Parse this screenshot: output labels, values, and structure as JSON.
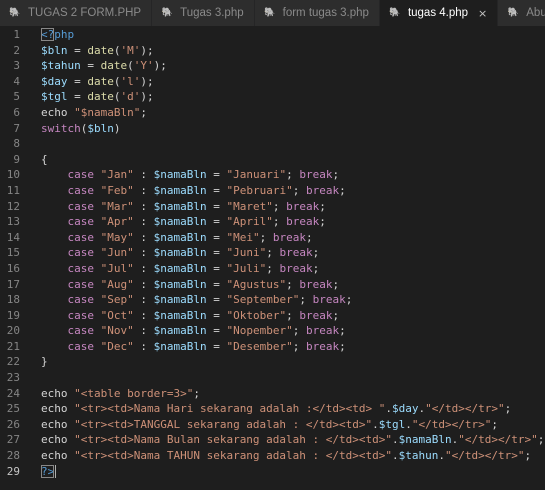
{
  "tabs": [
    {
      "label": "TUGAS 2 FORM.PHP",
      "active": false
    },
    {
      "label": "Tugas 3.php",
      "active": false
    },
    {
      "label": "form tugas 3.php",
      "active": false
    },
    {
      "label": "tugas 4.php",
      "active": true
    },
    {
      "label": "Abuj",
      "active": false
    }
  ],
  "tab_icon": "php-elephant-icon",
  "close_glyph": "×",
  "editor": {
    "current_line": 29,
    "lines": [
      {
        "n": "1",
        "tokens": [
          {
            "t": "<?",
            "c": "t-tag",
            "m": true
          },
          {
            "t": "php",
            "c": "t-tag"
          }
        ]
      },
      {
        "n": "2",
        "tokens": [
          {
            "t": "$bln",
            "c": "t-var"
          },
          {
            "t": " = ",
            "c": "t-plain"
          },
          {
            "t": "date",
            "c": "t-fn"
          },
          {
            "t": "(",
            "c": "t-plain"
          },
          {
            "t": "'M'",
            "c": "t-str"
          },
          {
            "t": ");",
            "c": "t-plain"
          }
        ]
      },
      {
        "n": "3",
        "tokens": [
          {
            "t": "$tahun",
            "c": "t-var"
          },
          {
            "t": " = ",
            "c": "t-plain"
          },
          {
            "t": "date",
            "c": "t-fn"
          },
          {
            "t": "(",
            "c": "t-plain"
          },
          {
            "t": "'Y'",
            "c": "t-str"
          },
          {
            "t": ");",
            "c": "t-plain"
          }
        ]
      },
      {
        "n": "4",
        "tokens": [
          {
            "t": "$day",
            "c": "t-var"
          },
          {
            "t": " = ",
            "c": "t-plain"
          },
          {
            "t": "date",
            "c": "t-fn"
          },
          {
            "t": "(",
            "c": "t-plain"
          },
          {
            "t": "'l'",
            "c": "t-str"
          },
          {
            "t": ");",
            "c": "t-plain"
          }
        ]
      },
      {
        "n": "5",
        "tokens": [
          {
            "t": "$tgl",
            "c": "t-var"
          },
          {
            "t": " = ",
            "c": "t-plain"
          },
          {
            "t": "date",
            "c": "t-fn"
          },
          {
            "t": "(",
            "c": "t-plain"
          },
          {
            "t": "'d'",
            "c": "t-str"
          },
          {
            "t": ");",
            "c": "t-plain"
          }
        ]
      },
      {
        "n": "6",
        "tokens": [
          {
            "t": "echo",
            "c": "t-plain"
          },
          {
            "t": " ",
            "c": "t-plain"
          },
          {
            "t": "\"$namaBln\"",
            "c": "t-str"
          },
          {
            "t": ";",
            "c": "t-plain"
          }
        ]
      },
      {
        "n": "7",
        "tokens": [
          {
            "t": "switch",
            "c": "t-kw"
          },
          {
            "t": "(",
            "c": "t-plain"
          },
          {
            "t": "$bln",
            "c": "t-var"
          },
          {
            "t": ")",
            "c": "t-plain"
          }
        ]
      },
      {
        "n": "8",
        "tokens": []
      },
      {
        "n": "9",
        "tokens": [
          {
            "t": "{",
            "c": "t-plain"
          }
        ]
      },
      {
        "n": "10",
        "tokens": [
          {
            "t": "    case ",
            "c": "t-kw"
          },
          {
            "t": "\"Jan\"",
            "c": "t-str"
          },
          {
            "t": " : ",
            "c": "t-plain"
          },
          {
            "t": "$namaBln",
            "c": "t-var"
          },
          {
            "t": " = ",
            "c": "t-plain"
          },
          {
            "t": "\"Januari\"",
            "c": "t-str"
          },
          {
            "t": "; ",
            "c": "t-plain"
          },
          {
            "t": "break",
            "c": "t-kw"
          },
          {
            "t": ";",
            "c": "t-plain"
          }
        ]
      },
      {
        "n": "11",
        "tokens": [
          {
            "t": "    case ",
            "c": "t-kw"
          },
          {
            "t": "\"Feb\"",
            "c": "t-str"
          },
          {
            "t": " : ",
            "c": "t-plain"
          },
          {
            "t": "$namaBln",
            "c": "t-var"
          },
          {
            "t": " = ",
            "c": "t-plain"
          },
          {
            "t": "\"Pebruari\"",
            "c": "t-str"
          },
          {
            "t": "; ",
            "c": "t-plain"
          },
          {
            "t": "break",
            "c": "t-kw"
          },
          {
            "t": ";",
            "c": "t-plain"
          }
        ]
      },
      {
        "n": "12",
        "tokens": [
          {
            "t": "    case ",
            "c": "t-kw"
          },
          {
            "t": "\"Mar\"",
            "c": "t-str"
          },
          {
            "t": " : ",
            "c": "t-plain"
          },
          {
            "t": "$namaBln",
            "c": "t-var"
          },
          {
            "t": " = ",
            "c": "t-plain"
          },
          {
            "t": "\"Maret\"",
            "c": "t-str"
          },
          {
            "t": "; ",
            "c": "t-plain"
          },
          {
            "t": "break",
            "c": "t-kw"
          },
          {
            "t": ";",
            "c": "t-plain"
          }
        ]
      },
      {
        "n": "13",
        "tokens": [
          {
            "t": "    case ",
            "c": "t-kw"
          },
          {
            "t": "\"Apr\"",
            "c": "t-str"
          },
          {
            "t": " : ",
            "c": "t-plain"
          },
          {
            "t": "$namaBln",
            "c": "t-var"
          },
          {
            "t": " = ",
            "c": "t-plain"
          },
          {
            "t": "\"April\"",
            "c": "t-str"
          },
          {
            "t": "; ",
            "c": "t-plain"
          },
          {
            "t": "break",
            "c": "t-kw"
          },
          {
            "t": ";",
            "c": "t-plain"
          }
        ]
      },
      {
        "n": "14",
        "tokens": [
          {
            "t": "    case ",
            "c": "t-kw"
          },
          {
            "t": "\"May\"",
            "c": "t-str"
          },
          {
            "t": " : ",
            "c": "t-plain"
          },
          {
            "t": "$namaBln",
            "c": "t-var"
          },
          {
            "t": " = ",
            "c": "t-plain"
          },
          {
            "t": "\"Mei\"",
            "c": "t-str"
          },
          {
            "t": "; ",
            "c": "t-plain"
          },
          {
            "t": "break",
            "c": "t-kw"
          },
          {
            "t": ";",
            "c": "t-plain"
          }
        ]
      },
      {
        "n": "15",
        "tokens": [
          {
            "t": "    case ",
            "c": "t-kw"
          },
          {
            "t": "\"Jun\"",
            "c": "t-str"
          },
          {
            "t": " : ",
            "c": "t-plain"
          },
          {
            "t": "$namaBln",
            "c": "t-var"
          },
          {
            "t": " = ",
            "c": "t-plain"
          },
          {
            "t": "\"Juni\"",
            "c": "t-str"
          },
          {
            "t": "; ",
            "c": "t-plain"
          },
          {
            "t": "break",
            "c": "t-kw"
          },
          {
            "t": ";",
            "c": "t-plain"
          }
        ]
      },
      {
        "n": "16",
        "tokens": [
          {
            "t": "    case ",
            "c": "t-kw"
          },
          {
            "t": "\"Jul\"",
            "c": "t-str"
          },
          {
            "t": " : ",
            "c": "t-plain"
          },
          {
            "t": "$namaBln",
            "c": "t-var"
          },
          {
            "t": " = ",
            "c": "t-plain"
          },
          {
            "t": "\"Juli\"",
            "c": "t-str"
          },
          {
            "t": "; ",
            "c": "t-plain"
          },
          {
            "t": "break",
            "c": "t-kw"
          },
          {
            "t": ";",
            "c": "t-plain"
          }
        ]
      },
      {
        "n": "17",
        "tokens": [
          {
            "t": "    case ",
            "c": "t-kw"
          },
          {
            "t": "\"Aug\"",
            "c": "t-str"
          },
          {
            "t": " : ",
            "c": "t-plain"
          },
          {
            "t": "$namaBln",
            "c": "t-var"
          },
          {
            "t": " = ",
            "c": "t-plain"
          },
          {
            "t": "\"Agustus\"",
            "c": "t-str"
          },
          {
            "t": "; ",
            "c": "t-plain"
          },
          {
            "t": "break",
            "c": "t-kw"
          },
          {
            "t": ";",
            "c": "t-plain"
          }
        ]
      },
      {
        "n": "18",
        "tokens": [
          {
            "t": "    case ",
            "c": "t-kw"
          },
          {
            "t": "\"Sep\"",
            "c": "t-str"
          },
          {
            "t": " : ",
            "c": "t-plain"
          },
          {
            "t": "$namaBln",
            "c": "t-var"
          },
          {
            "t": " = ",
            "c": "t-plain"
          },
          {
            "t": "\"September\"",
            "c": "t-str"
          },
          {
            "t": "; ",
            "c": "t-plain"
          },
          {
            "t": "break",
            "c": "t-kw"
          },
          {
            "t": ";",
            "c": "t-plain"
          }
        ]
      },
      {
        "n": "19",
        "tokens": [
          {
            "t": "    case ",
            "c": "t-kw"
          },
          {
            "t": "\"Oct\"",
            "c": "t-str"
          },
          {
            "t": " : ",
            "c": "t-plain"
          },
          {
            "t": "$namaBln",
            "c": "t-var"
          },
          {
            "t": " = ",
            "c": "t-plain"
          },
          {
            "t": "\"Oktober\"",
            "c": "t-str"
          },
          {
            "t": "; ",
            "c": "t-plain"
          },
          {
            "t": "break",
            "c": "t-kw"
          },
          {
            "t": ";",
            "c": "t-plain"
          }
        ]
      },
      {
        "n": "20",
        "tokens": [
          {
            "t": "    case ",
            "c": "t-kw"
          },
          {
            "t": "\"Nov\"",
            "c": "t-str"
          },
          {
            "t": " : ",
            "c": "t-plain"
          },
          {
            "t": "$namaBln",
            "c": "t-var"
          },
          {
            "t": " = ",
            "c": "t-plain"
          },
          {
            "t": "\"Nopember\"",
            "c": "t-str"
          },
          {
            "t": "; ",
            "c": "t-plain"
          },
          {
            "t": "break",
            "c": "t-kw"
          },
          {
            "t": ";",
            "c": "t-plain"
          }
        ]
      },
      {
        "n": "21",
        "tokens": [
          {
            "t": "    case ",
            "c": "t-kw"
          },
          {
            "t": "\"Dec\"",
            "c": "t-str"
          },
          {
            "t": " : ",
            "c": "t-plain"
          },
          {
            "t": "$namaBln",
            "c": "t-var"
          },
          {
            "t": " = ",
            "c": "t-plain"
          },
          {
            "t": "\"Desember\"",
            "c": "t-str"
          },
          {
            "t": "; ",
            "c": "t-plain"
          },
          {
            "t": "break",
            "c": "t-kw"
          },
          {
            "t": ";",
            "c": "t-plain"
          }
        ]
      },
      {
        "n": "22",
        "tokens": [
          {
            "t": "}",
            "c": "t-plain"
          }
        ]
      },
      {
        "n": "23",
        "tokens": []
      },
      {
        "n": "24",
        "tokens": [
          {
            "t": "echo ",
            "c": "t-plain"
          },
          {
            "t": "\"<table border=3>\"",
            "c": "t-str"
          },
          {
            "t": ";",
            "c": "t-plain"
          }
        ]
      },
      {
        "n": "25",
        "tokens": [
          {
            "t": "echo ",
            "c": "t-plain"
          },
          {
            "t": "\"<tr><td>Nama Hari sekarang adalah :</td><td> \"",
            "c": "t-str"
          },
          {
            "t": ".",
            "c": "t-plain"
          },
          {
            "t": "$day",
            "c": "t-var"
          },
          {
            "t": ".",
            "c": "t-plain"
          },
          {
            "t": "\"</td></tr>\"",
            "c": "t-str"
          },
          {
            "t": ";",
            "c": "t-plain"
          }
        ]
      },
      {
        "n": "26",
        "tokens": [
          {
            "t": "echo ",
            "c": "t-plain"
          },
          {
            "t": "\"<tr><td>TANGGAL sekarang adalah : </td><td>\"",
            "c": "t-str"
          },
          {
            "t": ".",
            "c": "t-plain"
          },
          {
            "t": "$tgl",
            "c": "t-var"
          },
          {
            "t": ".",
            "c": "t-plain"
          },
          {
            "t": "\"</td></tr>\"",
            "c": "t-str"
          },
          {
            "t": ";",
            "c": "t-plain"
          }
        ]
      },
      {
        "n": "27",
        "tokens": [
          {
            "t": "echo ",
            "c": "t-plain"
          },
          {
            "t": "\"<tr><td>Nama Bulan sekarang adalah : </td><td>\"",
            "c": "t-str"
          },
          {
            "t": ".",
            "c": "t-plain"
          },
          {
            "t": "$namaBln",
            "c": "t-var"
          },
          {
            "t": ".",
            "c": "t-plain"
          },
          {
            "t": "\"</td></tr>\"",
            "c": "t-str"
          },
          {
            "t": ";",
            "c": "t-plain"
          }
        ]
      },
      {
        "n": "28",
        "tokens": [
          {
            "t": "echo ",
            "c": "t-plain"
          },
          {
            "t": "\"<tr><td>Nama TAHUN sekarang adalah : </td><td>\"",
            "c": "t-str"
          },
          {
            "t": ".",
            "c": "t-plain"
          },
          {
            "t": "$tahun",
            "c": "t-var"
          },
          {
            "t": ".",
            "c": "t-plain"
          },
          {
            "t": "\"</td></tr>\"",
            "c": "t-str"
          },
          {
            "t": ";",
            "c": "t-plain"
          }
        ]
      },
      {
        "n": "29",
        "tokens": [
          {
            "t": "?>",
            "c": "t-tag",
            "m": true,
            "cursor": true
          }
        ]
      }
    ]
  }
}
